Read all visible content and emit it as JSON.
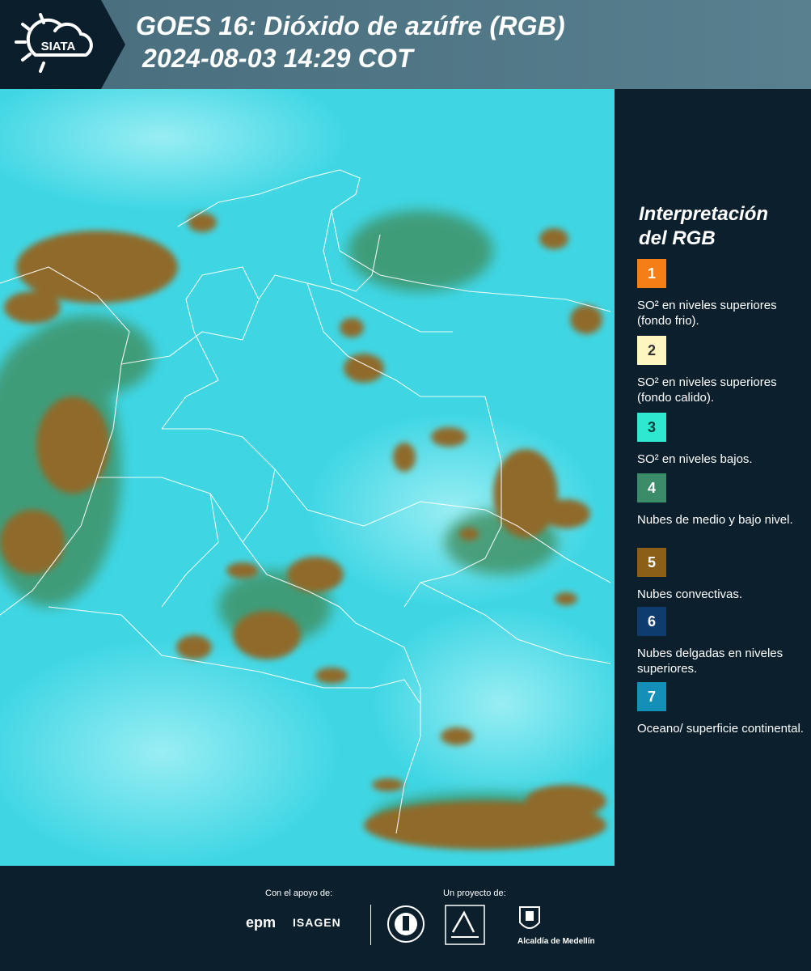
{
  "header": {
    "logo_text": "SIATA",
    "title_line1": "GOES 16: Dióxido de azúfre (RGB)",
    "title_line2": "2024-08-03 14:29 COT"
  },
  "colors": {
    "ocean": "#3fd6e4",
    "convective": "#8f6a2a",
    "mid_low": "#3d8a5c",
    "panel": "#0c1f2c",
    "header_band": "#52798a"
  },
  "legend": {
    "title": "Interpretación del RGB",
    "items": [
      {
        "number": "1",
        "label": "SO² en niveles superiores (fondo frio).",
        "color": "#f57f17"
      },
      {
        "number": "2",
        "label": "SO² en niveles superiores (fondo calido).",
        "color": "#fff5c0"
      },
      {
        "number": "3",
        "label": "SO² en niveles bajos.",
        "color": "#2ee8d0"
      },
      {
        "number": "4",
        "label": "Nubes de medio y bajo nivel.",
        "color": "#3a8d68"
      },
      {
        "number": "5",
        "label": "Nubes convectivas.",
        "color": "#8c5f18"
      },
      {
        "number": "6",
        "label": "Nubes delgadas en niveles superiores.",
        "color": "#0f3c6e"
      },
      {
        "number": "7",
        "label": "Oceano/ superficie continental.",
        "color": "#1490b8"
      }
    ]
  },
  "footer": {
    "support_text": "Con el apoyo de:",
    "project_text": "Un proyecto de:",
    "epm": "epm",
    "isagen": "ISAGEN",
    "alcaldia": "Alcaldía de Medellín"
  }
}
